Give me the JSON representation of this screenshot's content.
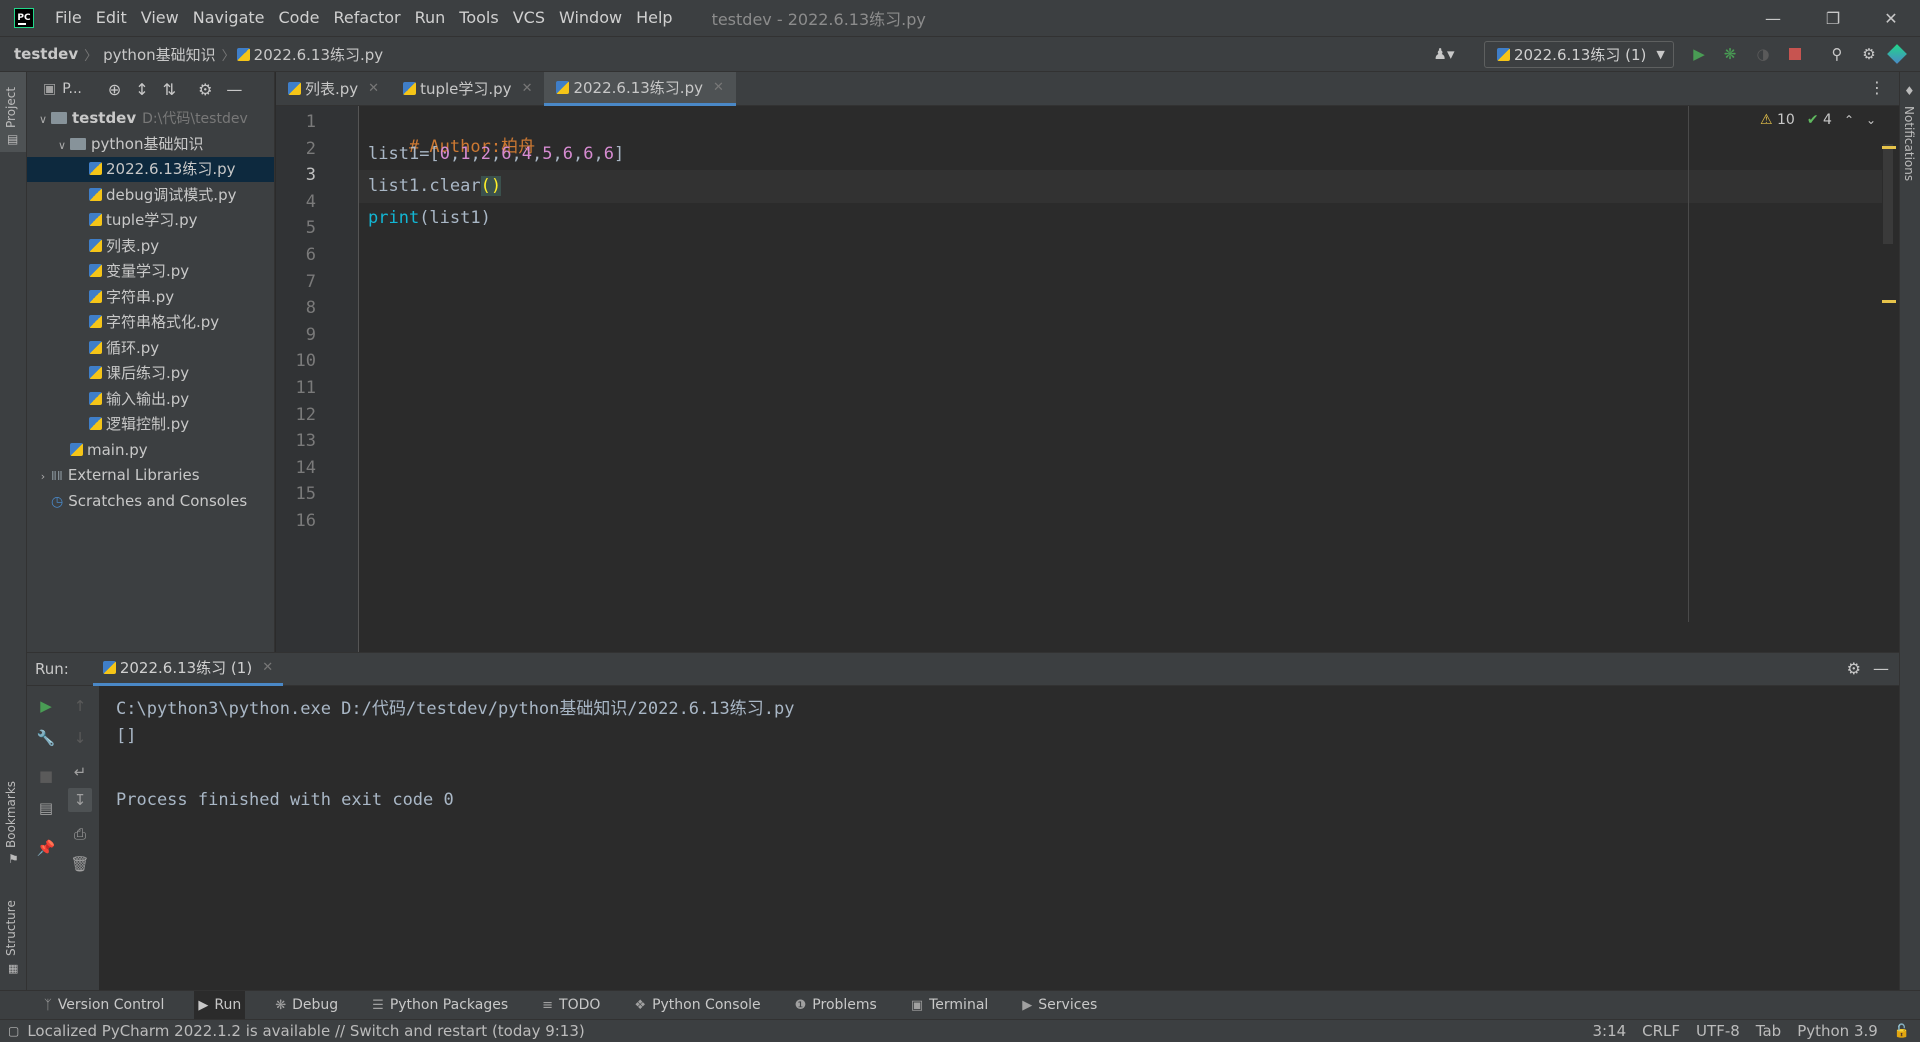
{
  "titlebar": {
    "menus": [
      "File",
      "Edit",
      "View",
      "Navigate",
      "Code",
      "Refactor",
      "Run",
      "Tools",
      "VCS",
      "Window",
      "Help"
    ],
    "window_title": "testdev - 2022.6.13练习.py",
    "logo_text": "PC"
  },
  "navbar": {
    "breadcrumbs": [
      "testdev",
      "python基础知识",
      "2022.6.13练习.py"
    ],
    "run_config": "2022.6.13练习 (1)"
  },
  "stripe": {
    "project": "Project",
    "bookmarks": "Bookmarks",
    "structure": "Structure",
    "notifications": "Notifications"
  },
  "project": {
    "title": "P...",
    "tree": [
      {
        "label": "testdev",
        "extra": "D:\\代码\\testdev",
        "type": "folder",
        "depth": 0,
        "expanded": true
      },
      {
        "label": "python基础知识",
        "type": "folder",
        "depth": 1,
        "expanded": true
      },
      {
        "label": "2022.6.13练习.py",
        "type": "py",
        "depth": 2,
        "selected": true
      },
      {
        "label": "debug调试模式.py",
        "type": "py",
        "depth": 2
      },
      {
        "label": "tuple学习.py",
        "type": "py",
        "depth": 2
      },
      {
        "label": "列表.py",
        "type": "py",
        "depth": 2
      },
      {
        "label": "变量学习.py",
        "type": "py",
        "depth": 2
      },
      {
        "label": "字符串.py",
        "type": "py",
        "depth": 2
      },
      {
        "label": "字符串格式化.py",
        "type": "py",
        "depth": 2
      },
      {
        "label": "循环.py",
        "type": "py",
        "depth": 2
      },
      {
        "label": "课后练习.py",
        "type": "py",
        "depth": 2
      },
      {
        "label": "输入输出.py",
        "type": "py",
        "depth": 2
      },
      {
        "label": "逻辑控制.py",
        "type": "py",
        "depth": 2
      },
      {
        "label": "main.py",
        "type": "py",
        "depth": 1
      },
      {
        "label": "External Libraries",
        "type": "lib",
        "depth": 0
      },
      {
        "label": "Scratches and Consoles",
        "type": "scratch",
        "depth": 0
      }
    ]
  },
  "editor": {
    "tabs": [
      "列表.py",
      "tuple学习.py",
      "2022.6.13练习.py"
    ],
    "active_tab": 2,
    "line_numbers": [
      "1",
      "2",
      "3",
      "4",
      "5",
      "6",
      "7",
      "8",
      "9",
      "10",
      "11",
      "12",
      "13",
      "14",
      "15",
      "16"
    ],
    "current_line": 3,
    "code": {
      "line1": {
        "comment": "# Author:柏舟"
      },
      "line2": {
        "name": "list1",
        "op": "=",
        "open": "[",
        "items": [
          "0",
          "1",
          "2",
          "6",
          "4",
          "5",
          "6",
          "6",
          "6"
        ],
        "close": "]"
      },
      "line3": {
        "text": "list1.clear",
        "parens": "()"
      },
      "line4": {
        "fn": "print",
        "args": "(list1)"
      }
    },
    "warnings": "10",
    "checks": "4"
  },
  "run": {
    "label": "Run:",
    "tab": "2022.6.13练习 (1)",
    "console": [
      "C:\\python3\\python.exe D:/代码/testdev/python基础知识/2022.6.13练习.py",
      "[]",
      "",
      "Process finished with exit code 0"
    ]
  },
  "bottom_tabs": [
    {
      "label": "Version Control",
      "icon": "branch-icon"
    },
    {
      "label": "Run",
      "icon": "play-icon",
      "active": true
    },
    {
      "label": "Debug",
      "icon": "bug-icon"
    },
    {
      "label": "Python Packages",
      "icon": "layers-icon"
    },
    {
      "label": "TODO",
      "icon": "list-icon"
    },
    {
      "label": "Python Console",
      "icon": "python-icon"
    },
    {
      "label": "Problems",
      "icon": "info-icon"
    },
    {
      "label": "Terminal",
      "icon": "terminal-icon"
    },
    {
      "label": "Services",
      "icon": "services-icon"
    }
  ],
  "status": {
    "message": "Localized PyCharm 2022.1.2 is available // Switch and restart (today 9:13)",
    "position": "3:14",
    "line_sep": "CRLF",
    "encoding": "UTF-8",
    "indent": "Tab",
    "interpreter": "Python 3.9"
  },
  "colors": {
    "accent": "#4a88c7",
    "run_green": "#499c54",
    "stop_red": "#c75450"
  }
}
